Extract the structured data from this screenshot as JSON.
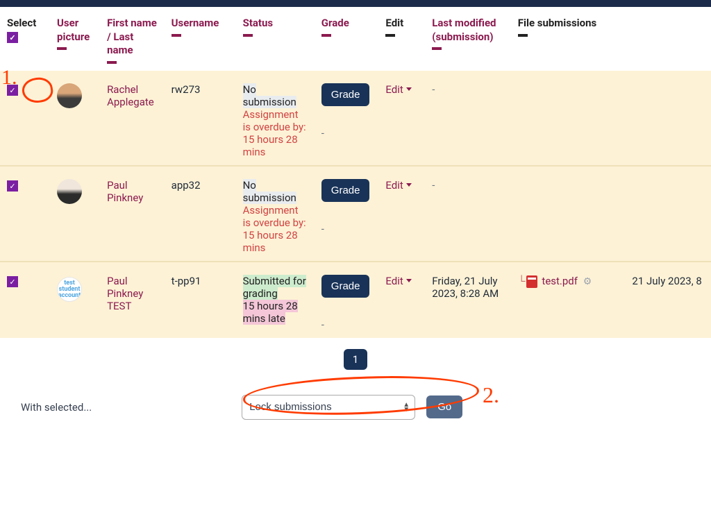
{
  "headers": {
    "select": "Select",
    "picture": "User picture",
    "name": "First name / Last name",
    "username": "Username",
    "status": "Status",
    "grade": "Grade",
    "edit": "Edit",
    "modified": "Last modified (submission)",
    "files": "File submissions"
  },
  "status_text": {
    "no_submission": "No submission",
    "overdue": "Assignment is overdue by: 15 hours 28 mins",
    "submitted": "Submitted for grading",
    "late": "15 hours 28 mins late"
  },
  "rows": [
    {
      "name": "Rachel Applegate",
      "username": "rw273",
      "status": "nosub",
      "modified": "-",
      "files": null,
      "extra": ""
    },
    {
      "name": "Paul Pinkney",
      "username": "app32",
      "status": "nosub",
      "modified": "-",
      "files": null,
      "extra": ""
    },
    {
      "name": "Paul Pinkney TEST",
      "username": "t-pp91",
      "status": "submitted",
      "modified": "Friday, 21 July 2023, 8:28 AM",
      "files": "test.pdf",
      "extra": "21 July 2023, 8"
    }
  ],
  "buttons": {
    "grade": "Grade",
    "edit": "Edit",
    "go": "Go"
  },
  "pager": {
    "current": "1"
  },
  "bulk": {
    "label": "With selected...",
    "selected_option": "Lock submissions"
  },
  "avatar_test_text": "test student account",
  "annotations": {
    "one": "1.",
    "two": "2."
  }
}
